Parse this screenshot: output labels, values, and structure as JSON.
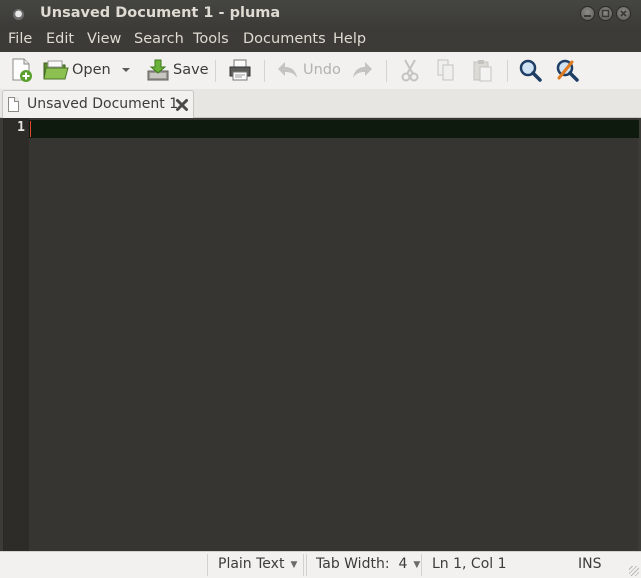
{
  "window": {
    "title": "Unsaved Document 1 - pluma",
    "controls": [
      "minimize",
      "maximize",
      "close"
    ]
  },
  "menubar": {
    "items": [
      "File",
      "Edit",
      "View",
      "Search",
      "Tools",
      "Documents",
      "Help"
    ]
  },
  "toolbar": {
    "new_icon": "new-document-icon",
    "open_label": "Open",
    "save_label": "Save",
    "print_icon": "printer-icon",
    "undo_label": "Undo",
    "redo_icon": "redo-icon",
    "cut_icon": "scissors-icon",
    "copy_icon": "copy-icon",
    "paste_icon": "paste-icon",
    "find_icon": "find-icon",
    "replace_icon": "find-replace-icon"
  },
  "tabs": [
    {
      "label": "Unsaved Document 1",
      "active": true
    }
  ],
  "editor": {
    "line_numbers": [
      "1"
    ],
    "content": ""
  },
  "statusbar": {
    "language": "Plain Text",
    "tab_width": "Tab Width:  4",
    "position": "Ln 1, Col 1",
    "mode": "INS"
  },
  "colors": {
    "editor_bg": "#363531",
    "current_line": "#0d1a0d",
    "cursor": "#e04a2a",
    "chrome_dark": "#3c3b37",
    "chrome_light": "#f2f1f0"
  }
}
